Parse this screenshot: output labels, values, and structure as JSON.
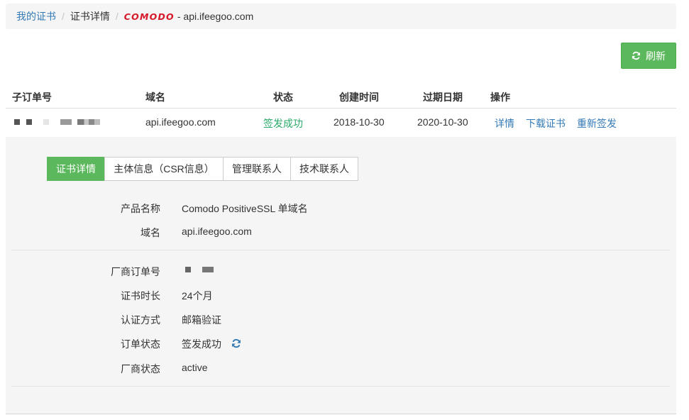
{
  "breadcrumb": {
    "my_certs": "我的证书",
    "cert_detail": "证书详情",
    "brand_logo": "COMODO",
    "domain_suffix": "- api.ifeegoo.com"
  },
  "toolbar": {
    "refresh_label": "刷新"
  },
  "table": {
    "headers": [
      "子订单号",
      "域名",
      "状态",
      "创建时间",
      "过期日期",
      "操作"
    ],
    "row": {
      "domain": "api.ifeegoo.com",
      "status": "签发成功",
      "created": "2018-10-30",
      "expires": "2020-10-30",
      "actions": [
        "详情",
        "下载证书",
        "重新签发"
      ]
    }
  },
  "tabs": [
    "证书详情",
    "主体信息（CSR信息）",
    "管理联系人",
    "技术联系人"
  ],
  "details": {
    "product_label": "产品名称",
    "product_value": "Comodo PositiveSSL 单域名",
    "domain_label": "域名",
    "domain_value": "api.ifeegoo.com",
    "vendor_order_label": "厂商订单号",
    "duration_label": "证书时长",
    "duration_value": "24个月",
    "validation_label": "认证方式",
    "validation_value": "邮箱验证",
    "order_status_label": "订单状态",
    "order_status_value": "签发成功",
    "vendor_status_label": "厂商状态",
    "vendor_status_value": "active"
  },
  "colors": {
    "accent_green": "#5cb85c",
    "status_green": "#2aab6a",
    "link_blue": "#337ab7",
    "brand_red": "#d7182a"
  }
}
